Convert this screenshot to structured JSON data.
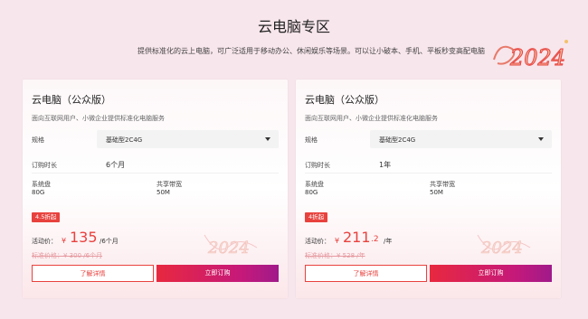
{
  "section": {
    "title": "云电脑专区",
    "subtitle": "提供标准化的云上电脑，可广泛适用于移动办公、休闲娱乐等场景。可以让小破本、手机、平板秒变高配电脑",
    "decoration_text": "2024"
  },
  "colors": {
    "accent": "#e8423e",
    "buy_gradient_start": "#e8283f",
    "buy_gradient_end": "#a01a8a",
    "page_background": "#f7e6ec"
  },
  "cards": [
    {
      "title": "云电脑（公众版）",
      "description": "面向互联网用户、小微企业提供标准化电脑服务",
      "spec_label": "规格",
      "spec_value": "基础型2C4G",
      "duration_label": "订购时长",
      "duration_value": "6个月",
      "disk_label": "系统盘",
      "disk_value": "80G",
      "bandwidth_label": "共享带宽",
      "bandwidth_value": "50M",
      "discount_badge": "4.5折起",
      "price_label": "活动价：",
      "currency": "¥",
      "price": "135",
      "price_unit": "/6个月",
      "original_price": "标准价格：¥ 300 /6个月",
      "detail_button": "了解详情",
      "buy_button": "立即订购"
    },
    {
      "title": "云电脑（公众版）",
      "description": "面向互联网用户、小微企业提供标准化电脑服务",
      "spec_label": "规格",
      "spec_value": "基础型2C4G",
      "duration_label": "订购时长",
      "duration_value": "1年",
      "disk_label": "系统盘",
      "disk_value": "80G",
      "bandwidth_label": "共享带宽",
      "bandwidth_value": "50M",
      "discount_badge": "4折起",
      "price_label": "活动价：",
      "currency": "¥",
      "price": "211",
      "price_decimal": ".2",
      "price_unit": "/年",
      "original_price": "标准价格：¥ 528 /年",
      "detail_button": "了解详情",
      "buy_button": "立即订购"
    }
  ]
}
